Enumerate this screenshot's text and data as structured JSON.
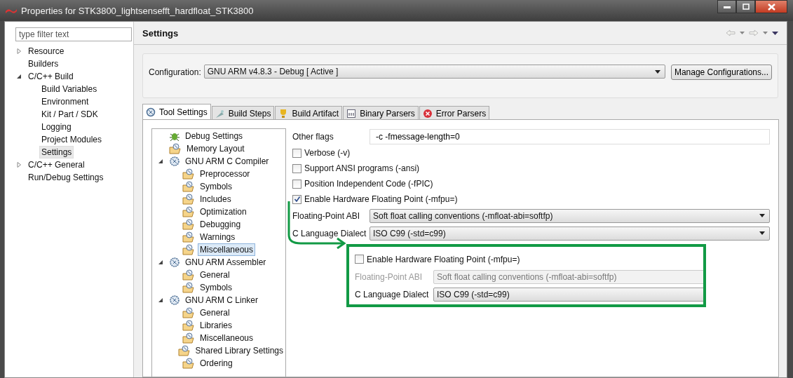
{
  "window": {
    "title": "Properties for STK3800_lightsensefft_hardfloat_STK3800"
  },
  "sidebar": {
    "filter": {
      "placeholder": "type filter text"
    },
    "items": [
      {
        "label": "Resource",
        "expanded": false,
        "selected": false
      },
      {
        "label": "Builders",
        "selected": false
      },
      {
        "label": "C/C++ Build",
        "expanded": true,
        "selected": false,
        "children": [
          {
            "label": "Build Variables",
            "selected": false
          },
          {
            "label": "Environment",
            "selected": false
          },
          {
            "label": "Kit / Part / SDK",
            "selected": false
          },
          {
            "label": "Logging",
            "selected": false
          },
          {
            "label": "Project Modules",
            "selected": false
          },
          {
            "label": "Settings",
            "selected": true
          }
        ]
      },
      {
        "label": "C/C++ General",
        "expanded": false,
        "selected": false
      },
      {
        "label": "Run/Debug Settings",
        "selected": false
      }
    ]
  },
  "page": {
    "title": "Settings",
    "configuration": {
      "label": "Configuration:",
      "value": "GNU ARM v4.8.3 - Debug  [ Active ]"
    },
    "manage_button": "Manage Configurations..."
  },
  "tabs": [
    {
      "label": "Tool Settings",
      "kind": "tool",
      "selected": true
    },
    {
      "label": "Build Steps",
      "kind": "steps",
      "selected": false
    },
    {
      "label": "Build Artifact",
      "kind": "artifact",
      "selected": false
    },
    {
      "label": "Binary Parsers",
      "kind": "binary",
      "selected": false
    },
    {
      "label": "Error Parsers",
      "kind": "error",
      "selected": false
    }
  ],
  "tool_tree": [
    {
      "label": "Debug Settings",
      "kind": "debug",
      "selected": false
    },
    {
      "label": "Memory Layout",
      "kind": "category",
      "selected": false
    },
    {
      "label": "GNU ARM C Compiler",
      "kind": "tool",
      "expanded": true,
      "selected": false,
      "children": [
        {
          "label": "Preprocessor",
          "kind": "category",
          "selected": false
        },
        {
          "label": "Symbols",
          "kind": "category",
          "selected": false
        },
        {
          "label": "Includes",
          "kind": "category",
          "selected": false
        },
        {
          "label": "Optimization",
          "kind": "category",
          "selected": false
        },
        {
          "label": "Debugging",
          "kind": "category",
          "selected": false
        },
        {
          "label": "Warnings",
          "kind": "category",
          "selected": false
        },
        {
          "label": "Miscellaneous",
          "kind": "category",
          "selected": true
        }
      ]
    },
    {
      "label": "GNU ARM Assembler",
      "kind": "tool",
      "expanded": true,
      "selected": false,
      "children": [
        {
          "label": "General",
          "kind": "category",
          "selected": false
        },
        {
          "label": "Symbols",
          "kind": "category",
          "selected": false
        }
      ]
    },
    {
      "label": "GNU ARM C Linker",
      "kind": "tool",
      "expanded": true,
      "selected": false,
      "children": [
        {
          "label": "General",
          "kind": "category",
          "selected": false
        },
        {
          "label": "Libraries",
          "kind": "category",
          "selected": false
        },
        {
          "label": "Miscellaneous",
          "kind": "category",
          "selected": false
        },
        {
          "label": "Shared Library Settings",
          "kind": "category",
          "selected": false
        },
        {
          "label": "Ordering",
          "kind": "category",
          "selected": false
        }
      ]
    }
  ],
  "options": [
    {
      "kind": "text",
      "label": "Other flags",
      "value": "-c -fmessage-length=0"
    },
    {
      "kind": "checkbox",
      "label": "Verbose (-v)",
      "checked": false
    },
    {
      "kind": "checkbox",
      "label": "Support ANSI programs (-ansi)",
      "checked": false
    },
    {
      "kind": "checkbox",
      "label": "Position Independent Code (-fPIC)",
      "checked": false
    },
    {
      "kind": "checkbox",
      "label": "Enable Hardware Floating Point (-mfpu=)",
      "checked": true
    },
    {
      "kind": "select",
      "label": "Floating-Point ABI",
      "value": "Soft float calling conventions (-mfloat-abi=softfp)",
      "disabled": false
    },
    {
      "kind": "select",
      "label": "C Language Dialect",
      "value": "ISO C99 (-std=c99)",
      "disabled": false
    }
  ],
  "callout": {
    "options": [
      {
        "kind": "checkbox",
        "label": "Enable Hardware Floating Point (-mfpu=)",
        "checked": false
      },
      {
        "kind": "select",
        "label": "Floating-Point ABI",
        "value": "Soft float calling conventions (-mfloat-abi=softfp)",
        "disabled": true
      },
      {
        "kind": "select",
        "label": "C Language Dialect",
        "value": "ISO C99 (-std=c99)",
        "disabled": false
      }
    ]
  }
}
